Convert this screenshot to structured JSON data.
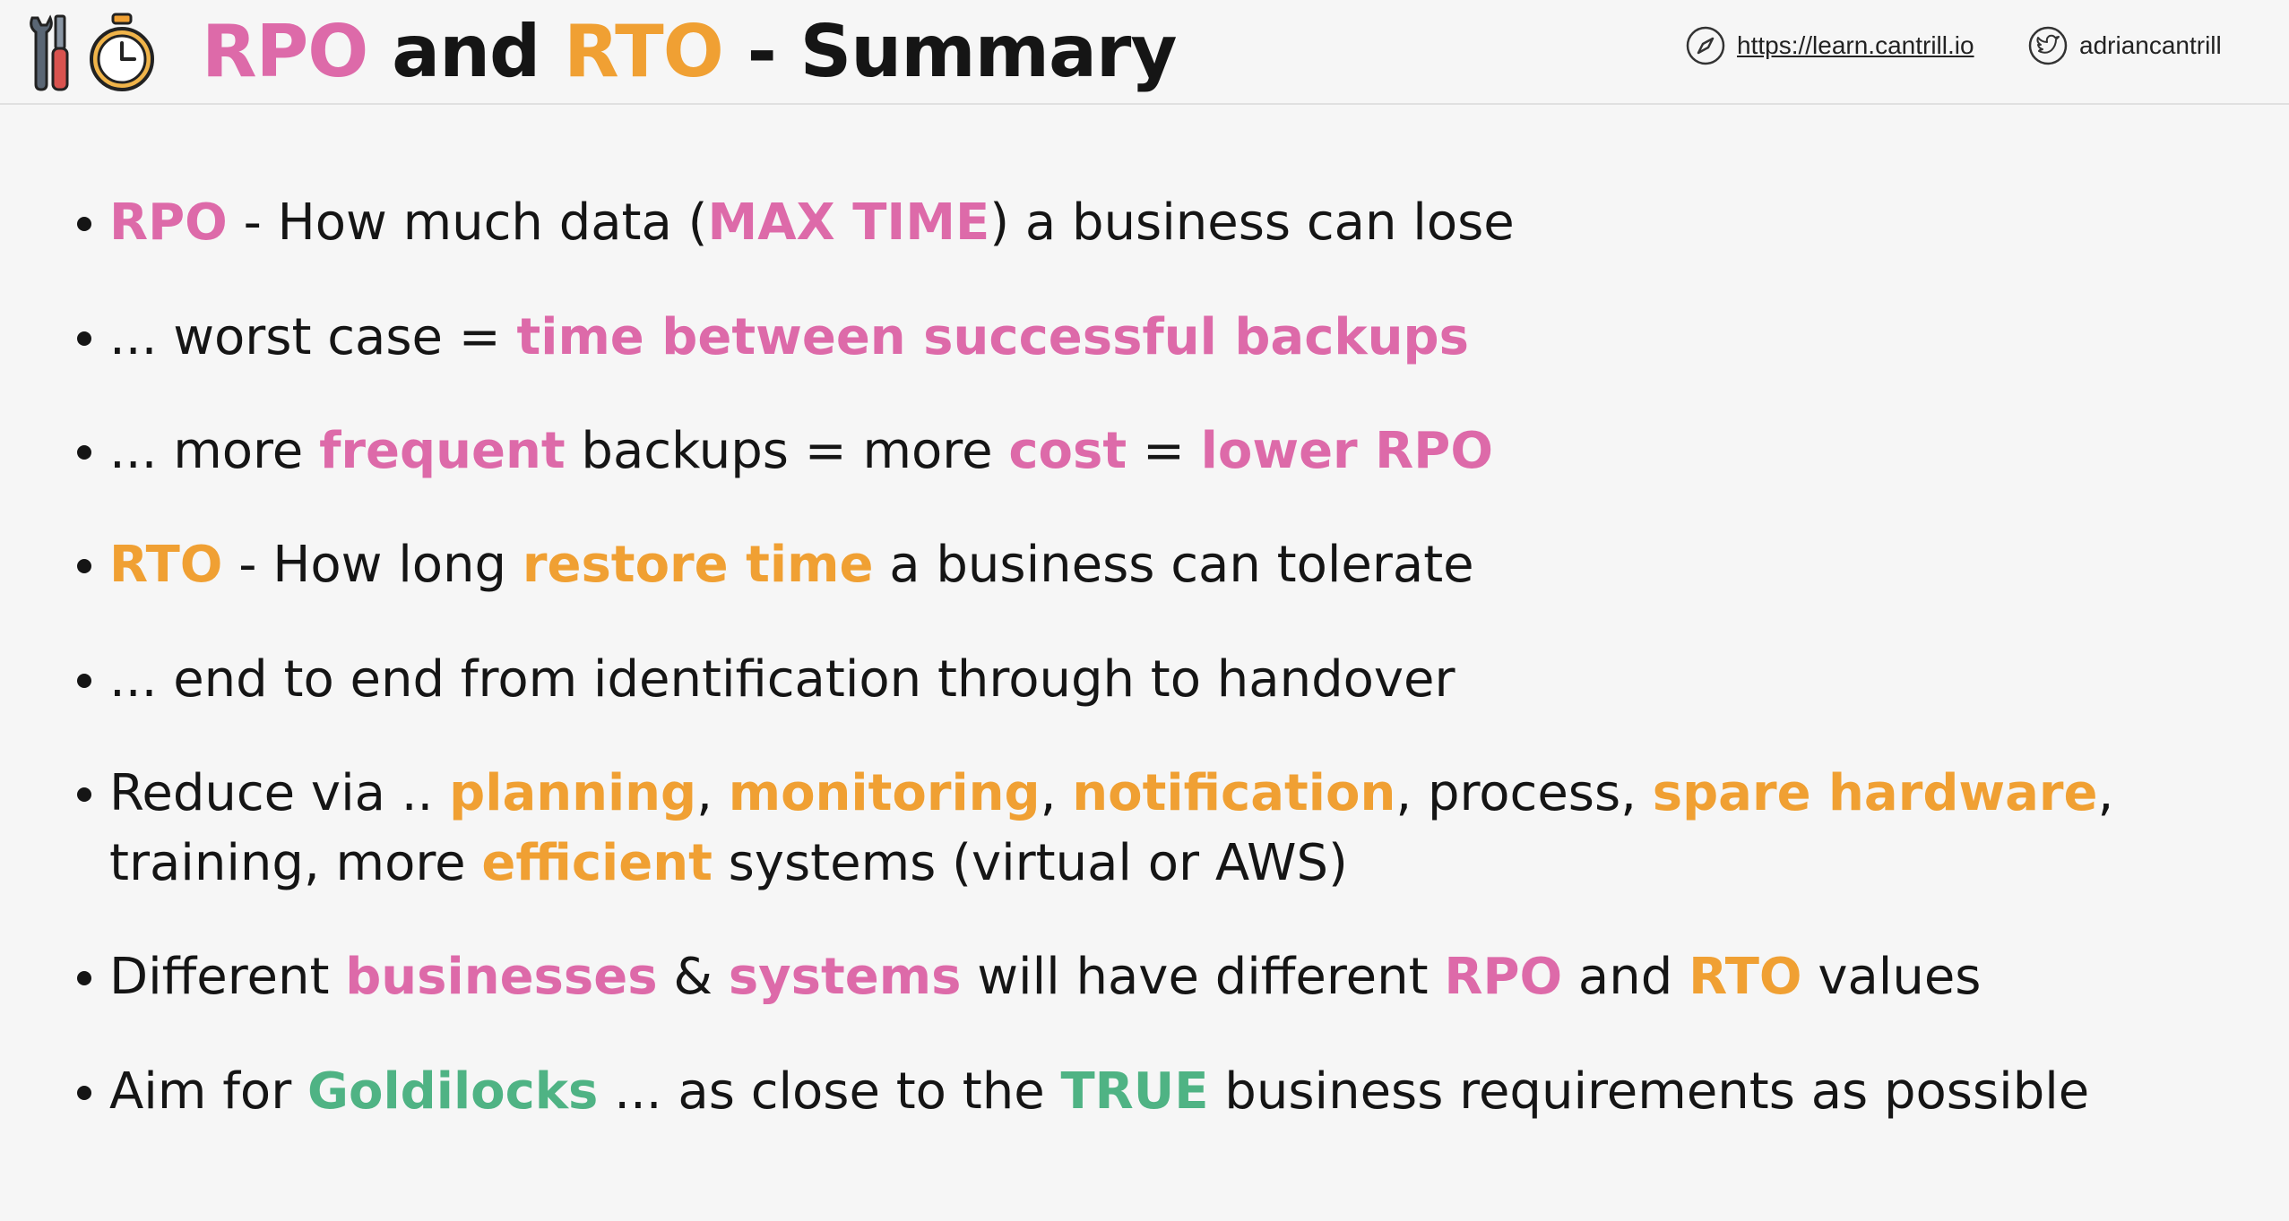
{
  "header": {
    "title_rpo": "RPO",
    "title_and": " and ",
    "title_rto": "RTO",
    "title_rest": " - Summary",
    "website": "https://learn.cantrill.io",
    "twitter": "adriancantrill",
    "icons": [
      "tools-icon",
      "stopwatch-icon",
      "compass-icon",
      "twitter-icon"
    ]
  },
  "colors": {
    "pink": "#dd6aa9",
    "orange": "#f0a033",
    "green": "#4fb384",
    "text": "#151515",
    "background": "#f6f6f6"
  },
  "bullets": [
    {
      "segments": [
        {
          "t": "RPO",
          "c": "p"
        },
        {
          "t": " - How much data (",
          "c": ""
        },
        {
          "t": "MAX TIME",
          "c": "p"
        },
        {
          "t": ") a business can lose",
          "c": ""
        }
      ]
    },
    {
      "segments": [
        {
          "t": "... worst case = ",
          "c": ""
        },
        {
          "t": "time between successful backups",
          "c": "p"
        }
      ]
    },
    {
      "segments": [
        {
          "t": "... more ",
          "c": ""
        },
        {
          "t": "frequent",
          "c": "p"
        },
        {
          "t": " backups = more ",
          "c": ""
        },
        {
          "t": "cost",
          "c": "p"
        },
        {
          "t": " = ",
          "c": ""
        },
        {
          "t": "lower RPO",
          "c": "p"
        }
      ]
    },
    {
      "segments": [
        {
          "t": "RTO",
          "c": "o"
        },
        {
          "t": " - How long ",
          "c": ""
        },
        {
          "t": "restore time",
          "c": "o"
        },
        {
          "t": " a business can tolerate",
          "c": ""
        }
      ]
    },
    {
      "segments": [
        {
          "t": "... end to end from identification through to handover",
          "c": ""
        }
      ]
    },
    {
      "segments": [
        {
          "t": "Reduce via .. ",
          "c": ""
        },
        {
          "t": "planning",
          "c": "o"
        },
        {
          "t": ", ",
          "c": ""
        },
        {
          "t": "monitoring",
          "c": "o"
        },
        {
          "t": ", ",
          "c": ""
        },
        {
          "t": "notification",
          "c": "o"
        },
        {
          "t": ", process, ",
          "c": ""
        },
        {
          "t": "spare hardware",
          "c": "o"
        },
        {
          "t": ", training, more ",
          "c": ""
        },
        {
          "t": "efficient",
          "c": "o"
        },
        {
          "t": " systems (virtual or AWS)",
          "c": ""
        }
      ]
    },
    {
      "segments": [
        {
          "t": "Different ",
          "c": ""
        },
        {
          "t": "businesses",
          "c": "p"
        },
        {
          "t": " & ",
          "c": ""
        },
        {
          "t": "systems",
          "c": "p"
        },
        {
          "t": " will have different ",
          "c": ""
        },
        {
          "t": "RPO",
          "c": "p"
        },
        {
          "t": " and ",
          "c": ""
        },
        {
          "t": "RTO",
          "c": "o"
        },
        {
          "t": " values",
          "c": ""
        }
      ]
    },
    {
      "segments": [
        {
          "t": "Aim for ",
          "c": ""
        },
        {
          "t": "Goldilocks",
          "c": "g"
        },
        {
          "t": " ... as close to the ",
          "c": ""
        },
        {
          "t": "TRUE",
          "c": "g"
        },
        {
          "t": " business requirements as possible",
          "c": ""
        }
      ]
    }
  ]
}
